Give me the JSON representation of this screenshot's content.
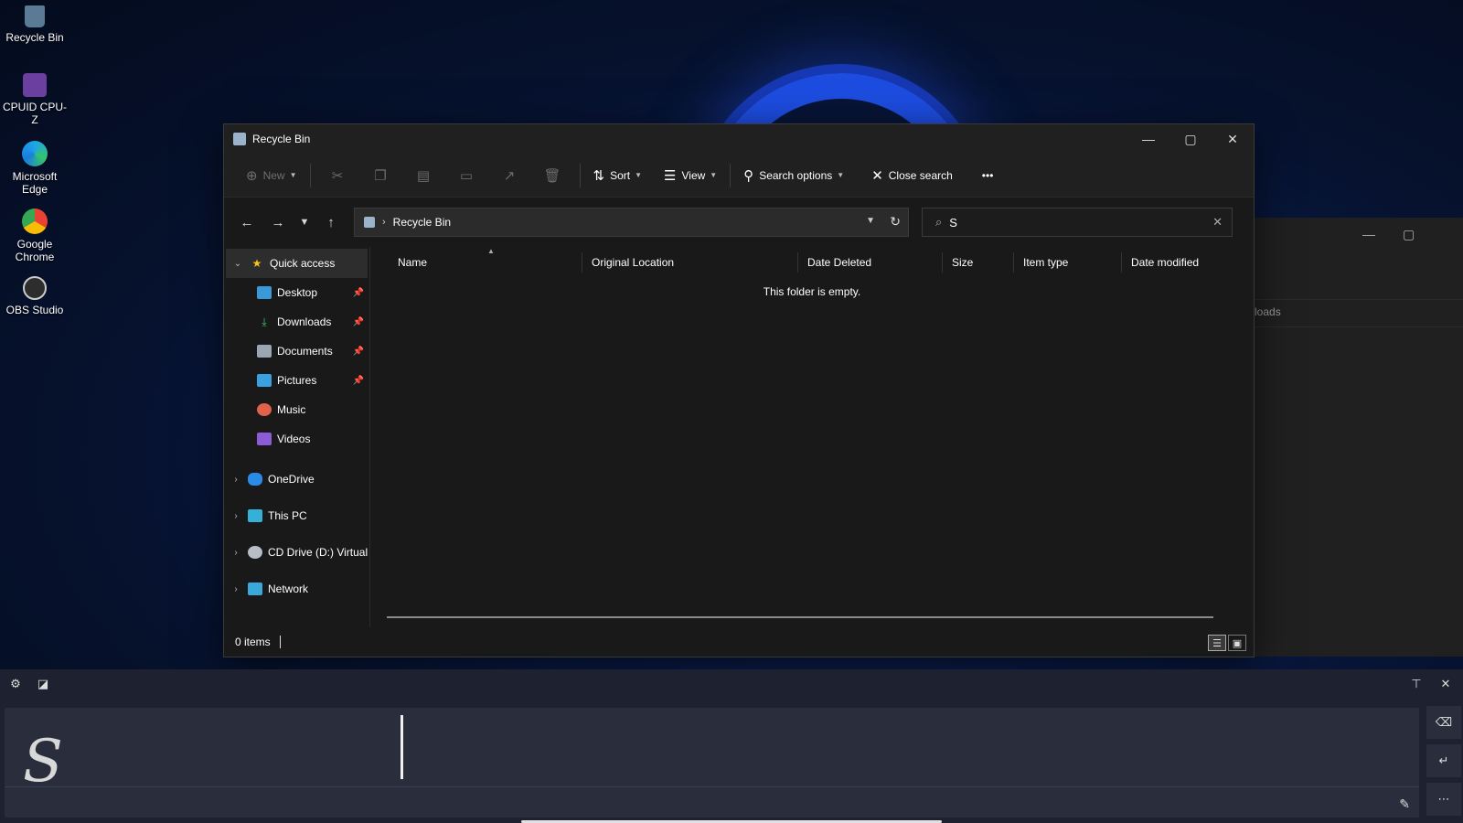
{
  "desktop": {
    "icons": [
      {
        "label": "Recycle Bin",
        "icon": "recycle-bin-icon"
      },
      {
        "label": "CPUID CPU-Z",
        "icon": "cpuz-icon"
      },
      {
        "label": "Microsoft Edge",
        "icon": "edge-icon"
      },
      {
        "label": "Google Chrome",
        "icon": "chrome-icon"
      },
      {
        "label": "OBS Studio",
        "icon": "obs-icon"
      }
    ]
  },
  "background_window": {
    "address_fragment": "ownloads"
  },
  "explorer": {
    "title": "Recycle Bin",
    "toolbar": {
      "new_label": "New",
      "sort_label": "Sort",
      "view_label": "View",
      "search_options_label": "Search options",
      "close_search_label": "Close search",
      "more_label": "•••"
    },
    "address": {
      "path": "Recycle Bin",
      "separator": "›"
    },
    "search": {
      "value": "S"
    },
    "navpane": {
      "quick_access": "Quick access",
      "quick_items": [
        {
          "label": "Desktop",
          "pinned": true
        },
        {
          "label": "Downloads",
          "pinned": true
        },
        {
          "label": "Documents",
          "pinned": true
        },
        {
          "label": "Pictures",
          "pinned": true
        },
        {
          "label": "Music",
          "pinned": false
        },
        {
          "label": "Videos",
          "pinned": false
        }
      ],
      "roots": [
        {
          "label": "OneDrive"
        },
        {
          "label": "This PC"
        },
        {
          "label": "CD Drive (D:) Virtual"
        },
        {
          "label": "Network"
        }
      ]
    },
    "columns": [
      "Name",
      "Original Location",
      "Date Deleted",
      "Size",
      "Item type",
      "Date modified"
    ],
    "empty_message": "This folder is empty.",
    "status": {
      "items": "0 items"
    }
  },
  "handwriting_panel": {
    "ink_text": "S"
  },
  "colors": {
    "accent": "#1d4de0",
    "window_bg": "#191919",
    "toolbar_bg": "#202020",
    "panel_bg": "#1e2230"
  }
}
